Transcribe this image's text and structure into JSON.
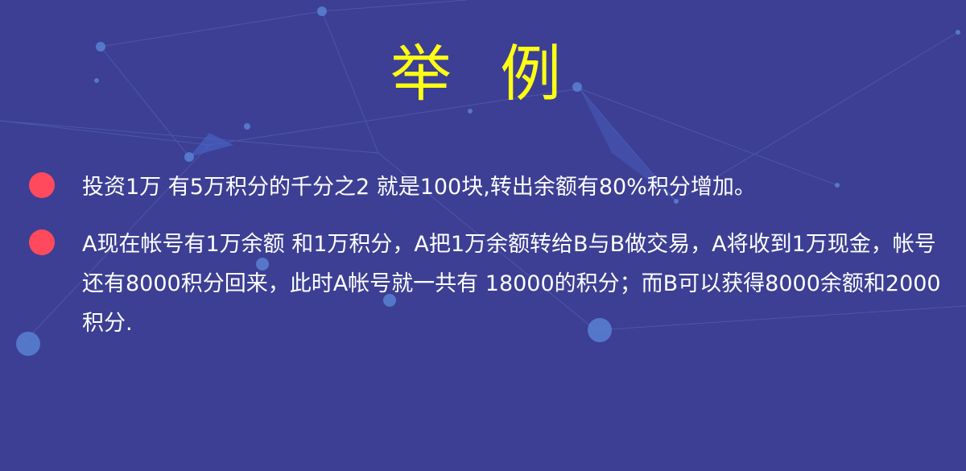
{
  "title": "举 例",
  "colors": {
    "background": "#3c3f93",
    "title": "#ffff14",
    "bullet_dot": "#ff4a5d",
    "text": "#ffffff"
  },
  "bullets": [
    {
      "text": "投资1万 有5万积分的千分之2  就是100块,转出余额有80%积分增加。"
    },
    {
      "text": "A现在帐号有1万余额 和1万积分，A把1万余额转给B与B做交易，A将收到1万现金，帐号还有8000积分回来，此时A帐号就一共有 18000的积分；而B可以获得8000余额和2000积分."
    }
  ]
}
